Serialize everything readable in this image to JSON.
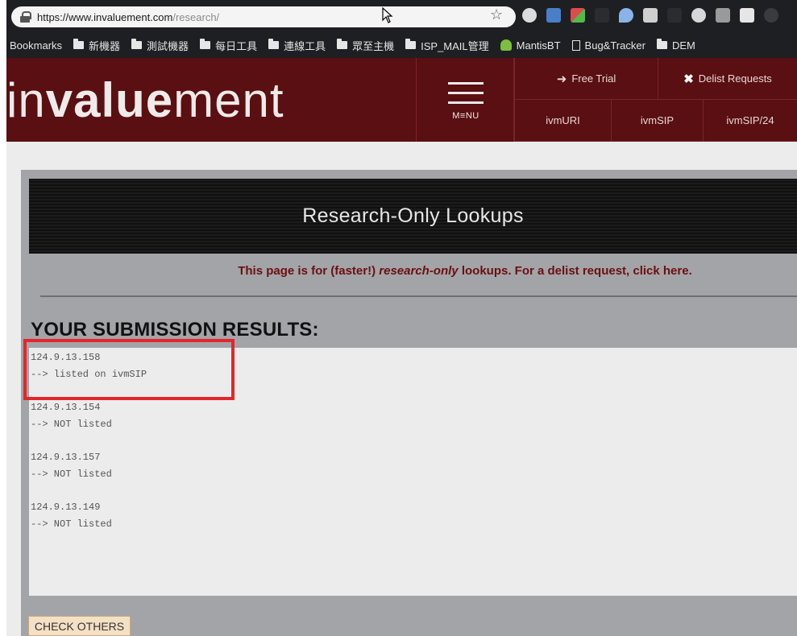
{
  "browser": {
    "url_host": "https://www.invaluement.com",
    "url_path": "/research/",
    "bookmarks_label": "Bookmarks",
    "bookmarks": [
      {
        "label": "新機器",
        "icon": "folder-icon"
      },
      {
        "label": "測試機器",
        "icon": "folder-icon"
      },
      {
        "label": "每日工具",
        "icon": "folder-icon"
      },
      {
        "label": "連線工具",
        "icon": "folder-icon"
      },
      {
        "label": "眾至主機",
        "icon": "folder-icon"
      },
      {
        "label": "ISP_MAIL管理",
        "icon": "folder-icon"
      },
      {
        "label": "MantisBT",
        "icon": "mantis-icon"
      },
      {
        "label": "Bug&Tracker",
        "icon": "doc-icon"
      },
      {
        "label": "DEM",
        "icon": "folder-icon"
      }
    ]
  },
  "header": {
    "logo_prefix": "in",
    "logo_bold": "value",
    "logo_suffix": "ment",
    "menu_label": "M≡NU",
    "free_trial": "Free Trial",
    "delist_requests": "Delist Requests",
    "nav": [
      "ivmURI",
      "ivmSIP",
      "ivmSIP/24"
    ]
  },
  "main": {
    "banner_title": "Research-Only Lookups",
    "notice_pre": "This page is for (faster!) ",
    "notice_em": "research-only",
    "notice_post": " lookups. For a delist request, click here.",
    "results_heading": "YOUR SUBMISSION RESULTS:",
    "results": [
      {
        "ip": "124.9.13.158",
        "status": "--> listed on ivmSIP"
      },
      {
        "ip": "124.9.13.154",
        "status": "--> NOT listed"
      },
      {
        "ip": "124.9.13.157",
        "status": "--> NOT listed"
      },
      {
        "ip": "124.9.13.149",
        "status": "--> NOT listed"
      }
    ],
    "check_others": "CHECK OTHERS"
  },
  "colors": {
    "header_bg": "#5a0f12",
    "notice_text": "#6b0f12",
    "highlight": "#e3262c"
  }
}
